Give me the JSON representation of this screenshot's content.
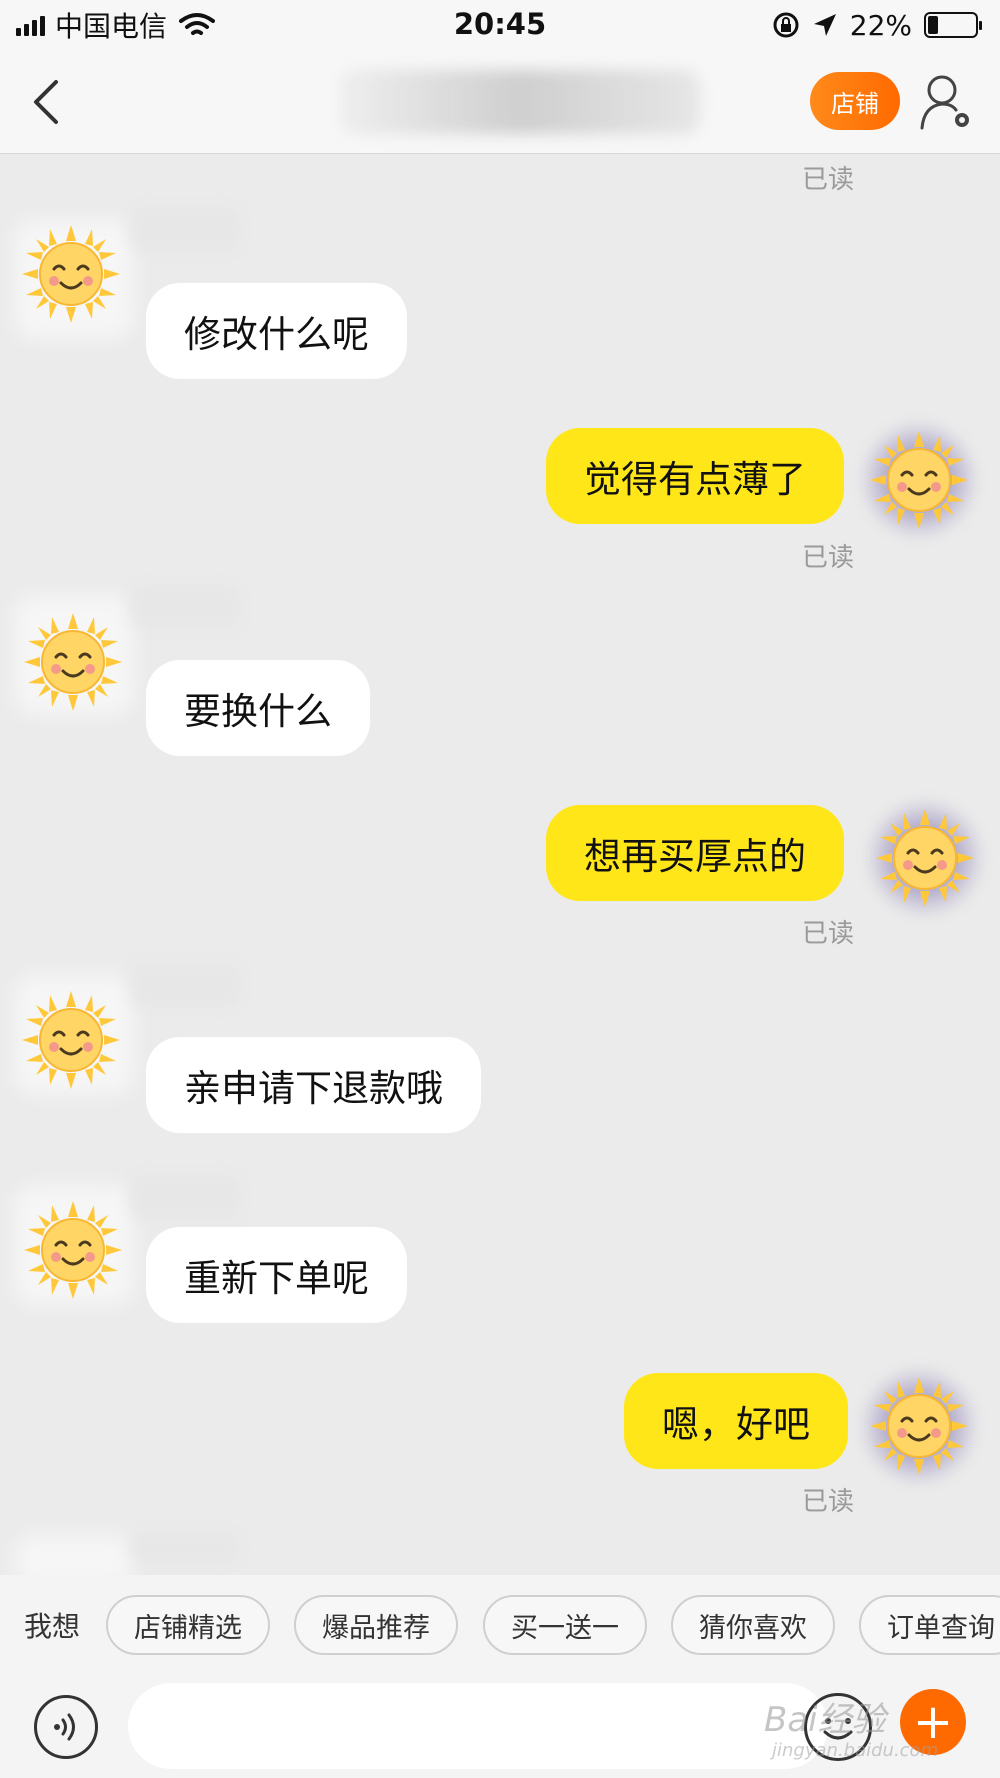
{
  "status_bar": {
    "carrier": "中国电信",
    "time": "20:45",
    "battery_percent_text": "22%",
    "battery_level": 0.22
  },
  "header": {
    "store_label": "店铺"
  },
  "colors": {
    "outgoing_bubble": "#ffe619",
    "incoming_bubble": "#ffffff",
    "accent": "#ff6a00",
    "background": "#ebebeb"
  },
  "chat": {
    "read_label": "已读",
    "messages": [
      {
        "direction": "incoming",
        "text": "修改什么呢"
      },
      {
        "direction": "outgoing",
        "text": "觉得有点薄了",
        "status": "已读"
      },
      {
        "direction": "incoming",
        "text": "要换什么"
      },
      {
        "direction": "outgoing",
        "text": "想再买厚点的",
        "status": "已读"
      },
      {
        "direction": "incoming",
        "text": "亲申请下退款哦"
      },
      {
        "direction": "incoming",
        "text": "重新下单呢"
      },
      {
        "direction": "outgoing",
        "text": "嗯，好吧",
        "status": "已读"
      }
    ]
  },
  "quick_replies": {
    "label": "我想",
    "chips": [
      "店铺精选",
      "爆品推荐",
      "买一送一",
      "猜你喜欢",
      "订单查询"
    ]
  },
  "input_bar": {
    "placeholder": "",
    "voice_icon": "voice-icon",
    "emoji_icon": "emoji-icon",
    "plus_label": "+"
  },
  "watermark": {
    "main": "Bai经验",
    "sub": "jingyan.baidu.com"
  }
}
